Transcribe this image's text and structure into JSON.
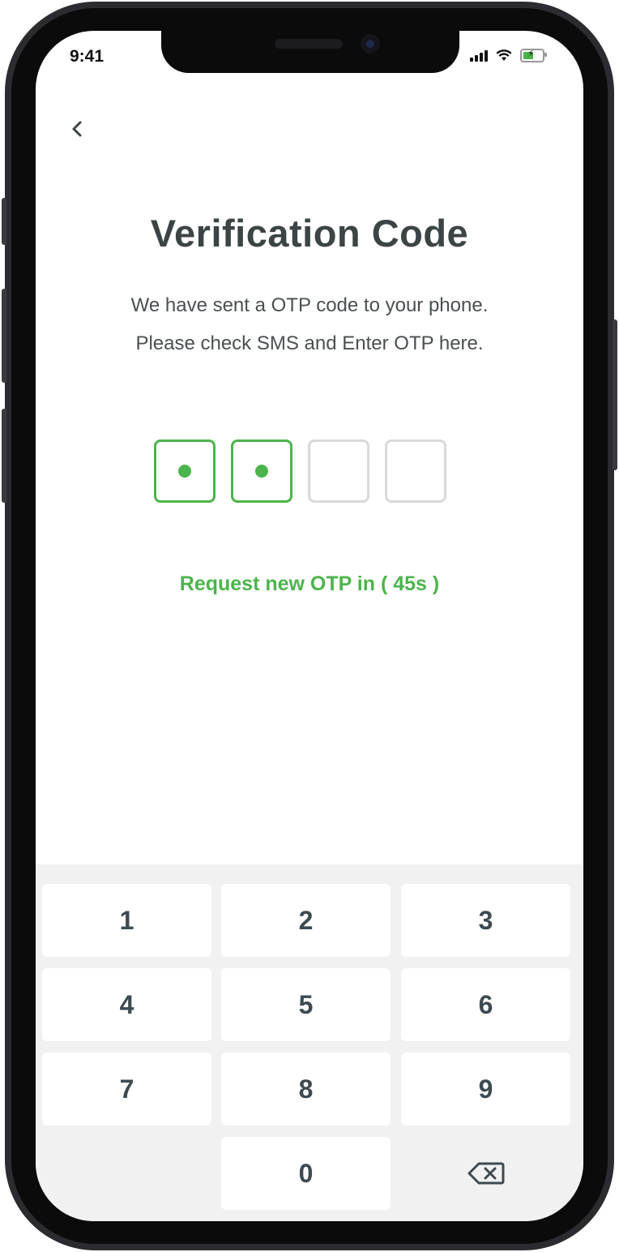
{
  "status_bar": {
    "time": "9:41"
  },
  "header": {
    "back_icon": "chevron-left-icon"
  },
  "content": {
    "title": "Verification Code",
    "subtitle_line1": "We have sent a OTP code to your phone.",
    "subtitle_line2": "Please check SMS and Enter OTP here.",
    "otp": {
      "length": 4,
      "filled": 2
    },
    "resend_text": "Request new OTP in ( 45s )"
  },
  "keypad": {
    "keys": [
      "1",
      "2",
      "3",
      "4",
      "5",
      "6",
      "7",
      "8",
      "9",
      "0"
    ],
    "delete_icon": "backspace-icon"
  },
  "colors": {
    "accent": "#4cb44c",
    "title": "#3d4446",
    "empty_box": "#d9d9d9",
    "keypad_bg": "#f1f1f1"
  }
}
